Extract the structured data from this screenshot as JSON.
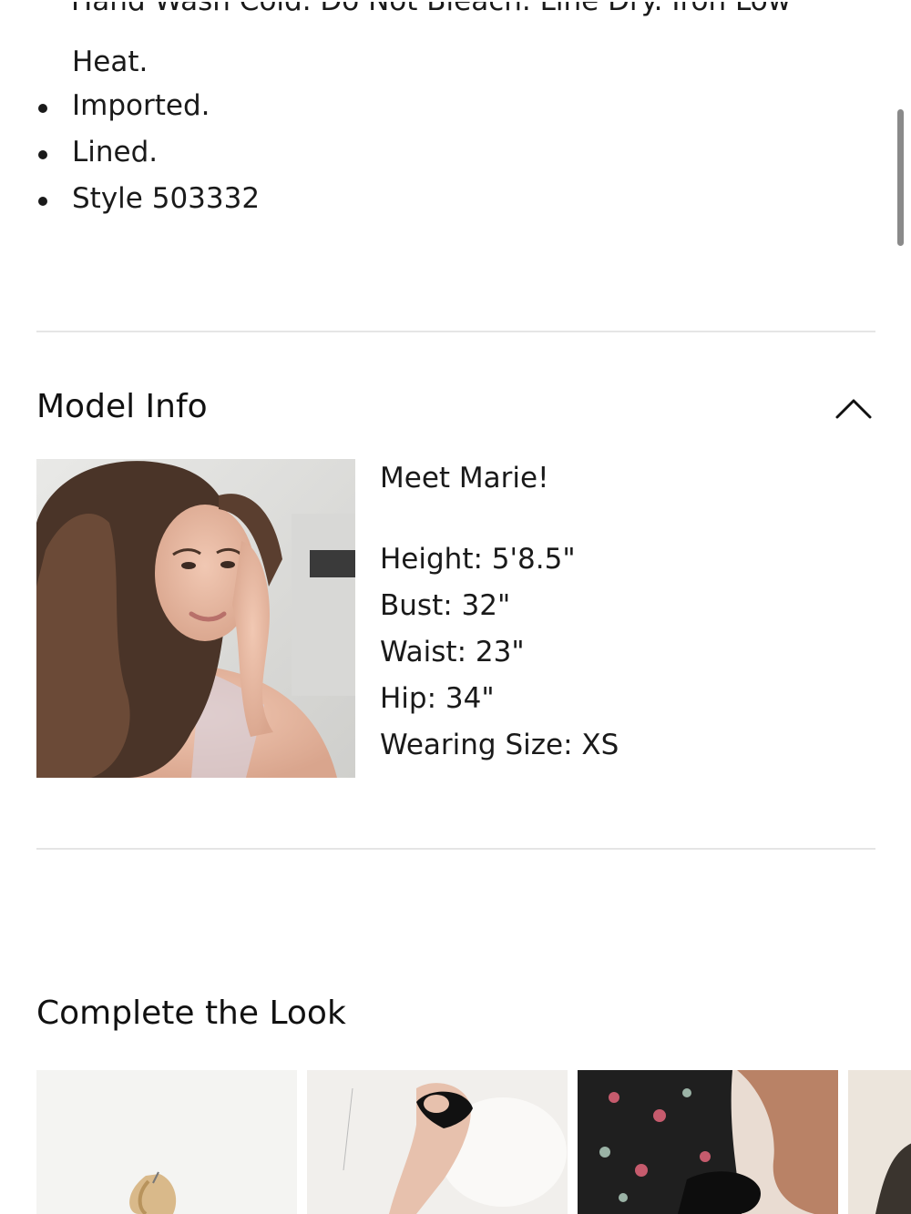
{
  "details": {
    "cut_line_text": "Hand Wash Cold. Do Not Bleach. Line Dry. Iron Low",
    "continued_text": "Heat.",
    "items": [
      {
        "text": "Imported."
      },
      {
        "text": "Lined."
      },
      {
        "text": "Style 503332"
      }
    ]
  },
  "model_info": {
    "title": "Model Info",
    "toggle_icon": "chevron-up-icon",
    "intro": "Meet Marie!",
    "stats": [
      {
        "text": "Height: 5'8.5\""
      },
      {
        "text": "Bust: 32\""
      },
      {
        "text": "Waist: 23\""
      },
      {
        "text": "Hip: 34\""
      },
      {
        "text": "Wearing Size: XS"
      }
    ]
  },
  "complete_the_look": {
    "title": "Complete the Look",
    "products": [
      {
        "name": "gold-hoop-earrings-image"
      },
      {
        "name": "black-strap-heel-image"
      },
      {
        "name": "floral-print-dress-image"
      },
      {
        "name": "mesh-accessory-image"
      }
    ]
  },
  "colors": {
    "text": "#1a1a1a",
    "divider": "#e5e5e5",
    "scrollbar": "#8a8a8a"
  }
}
